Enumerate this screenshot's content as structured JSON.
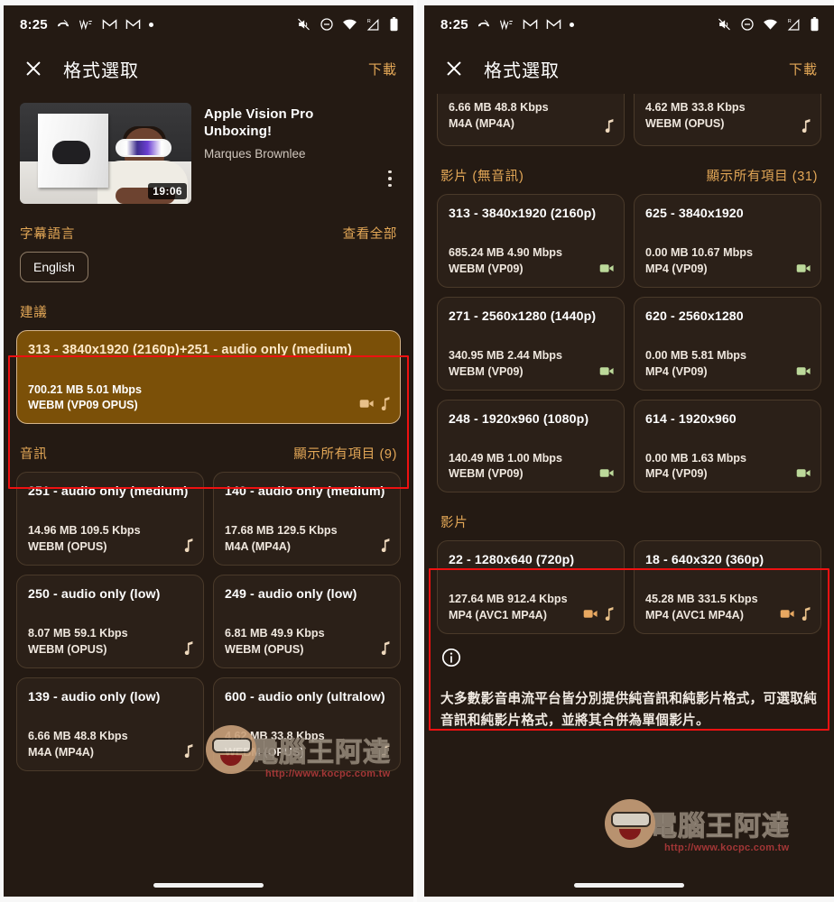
{
  "status_bar": {
    "time": "8:25",
    "left_icons": [
      "missed-call-icon",
      "vibrate-icon",
      "gmail-icon",
      "gmail-icon",
      "dot-icon"
    ],
    "right_icons": [
      "mute-icon",
      "do-not-disturb-icon",
      "wifi-icon",
      "signal-roaming-icon",
      "battery-icon"
    ]
  },
  "app_bar": {
    "close_icon": "close-icon",
    "title": "格式選取",
    "action": "下載"
  },
  "video": {
    "title": "Apple Vision Pro Unboxing!",
    "channel": "Marques Brownlee",
    "duration": "19:06",
    "menu_icon": "kebab-menu-icon"
  },
  "subtitles": {
    "header": "字幕語言",
    "action": "查看全部",
    "chips": [
      "English"
    ]
  },
  "recommended": {
    "header": "建議",
    "card": {
      "title": "313 - 3840x1920 (2160p)+251 - audio only (medium)",
      "size": "700.21 MB 5.01 Mbps",
      "format": "WEBM (VP09 OPUS)",
      "icons": [
        "video-icon",
        "music-note-icon"
      ],
      "selected": true
    }
  },
  "audio_section": {
    "header": "音訊",
    "action": "顯示所有項目 (9)",
    "cards": [
      {
        "title": "251 - audio only (medium)",
        "size": "14.96 MB 109.5 Kbps",
        "format": "WEBM (OPUS)",
        "icons": [
          "music-note-icon"
        ]
      },
      {
        "title": "140 - audio only (medium)",
        "size": "17.68 MB 129.5 Kbps",
        "format": "M4A (MP4A)",
        "icons": [
          "music-note-icon"
        ]
      },
      {
        "title": "250 - audio only (low)",
        "size": "8.07 MB 59.1 Kbps",
        "format": "WEBM (OPUS)",
        "icons": [
          "music-note-icon"
        ]
      },
      {
        "title": "249 - audio only (low)",
        "size": "6.81 MB 49.9 Kbps",
        "format": "WEBM (OPUS)",
        "icons": [
          "music-note-icon"
        ]
      },
      {
        "title": "139 - audio only (low)",
        "size": "6.66 MB 48.8 Kbps",
        "format": "M4A (MP4A)",
        "icons": [
          "music-note-icon"
        ]
      },
      {
        "title": "600 - audio only (ultralow)",
        "size": "4.62 MB 33.8 Kbps",
        "format": "WEBM (OPUS)",
        "icons": [
          "music-note-icon"
        ]
      }
    ]
  },
  "right_panel": {
    "partial_cards": [
      {
        "size": "6.66 MB 48.8 Kbps",
        "format": "M4A (MP4A)",
        "icons": [
          "music-note-icon"
        ]
      },
      {
        "size": "4.62 MB 33.8 Kbps",
        "format": "WEBM (OPUS)",
        "icons": [
          "music-note-icon"
        ]
      }
    ],
    "video_no_audio_section": {
      "header": "影片 (無音訊)",
      "action": "顯示所有項目 (31)",
      "cards": [
        {
          "title": "313 - 3840x1920 (2160p)",
          "size": "685.24 MB 4.90 Mbps",
          "format": "WEBM (VP09)",
          "icons": [
            "video-icon"
          ]
        },
        {
          "title": "625 - 3840x1920",
          "size": "0.00 MB 10.67 Mbps",
          "format": "MP4 (VP09)",
          "icons": [
            "video-icon"
          ]
        },
        {
          "title": "271 - 2560x1280 (1440p)",
          "size": "340.95 MB 2.44 Mbps",
          "format": "WEBM (VP09)",
          "icons": [
            "video-icon"
          ]
        },
        {
          "title": "620 - 2560x1280",
          "size": "0.00 MB 5.81 Mbps",
          "format": "MP4 (VP09)",
          "icons": [
            "video-icon"
          ]
        },
        {
          "title": "248 - 1920x960 (1080p)",
          "size": "140.49 MB 1.00 Mbps",
          "format": "WEBM (VP09)",
          "icons": [
            "video-icon"
          ]
        },
        {
          "title": "614 - 1920x960",
          "size": "0.00 MB 1.63 Mbps",
          "format": "MP4 (VP09)",
          "icons": [
            "video-icon"
          ]
        }
      ]
    },
    "video_section": {
      "header": "影片",
      "cards": [
        {
          "title": "22 - 1280x640 (720p)",
          "size": "127.64 MB 912.4 Kbps",
          "format": "MP4 (AVC1 MP4A)",
          "icons": [
            "video-icon",
            "music-note-icon"
          ]
        },
        {
          "title": "18 - 640x320 (360p)",
          "size": "45.28 MB 331.5 Kbps",
          "format": "MP4 (AVC1 MP4A)",
          "icons": [
            "video-icon",
            "music-note-icon"
          ]
        }
      ]
    },
    "info": {
      "icon": "info-icon",
      "text": "大多數影音串流平台皆分別提供純音訊和純影片格式，可選取純音訊和純影片格式，並將其合併為單個影片。"
    }
  },
  "watermark": {
    "brand": "電腦王阿達",
    "url": "http://www.kocpc.com.tw"
  },
  "colors": {
    "background": "#241a13",
    "card_background": "#2b2018",
    "accent": "#e4a857",
    "selected_card": "#7b5008",
    "annotation": "#ee1111",
    "video_icon_green": "#bcd99a",
    "video_icon_orange": "#e8a861"
  }
}
